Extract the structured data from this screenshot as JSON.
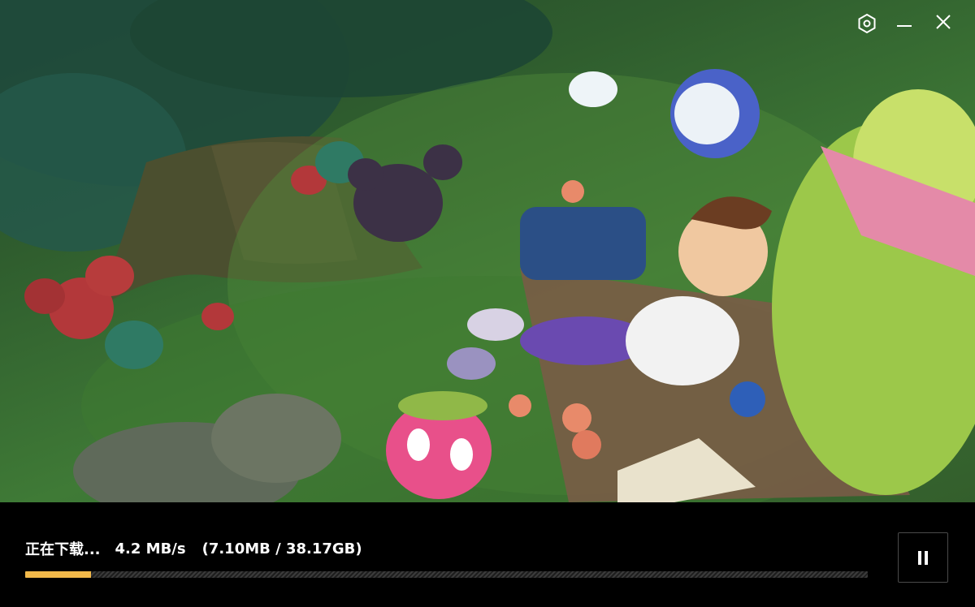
{
  "window": {
    "controls": [
      "settings-icon",
      "minimize-icon",
      "close-icon"
    ]
  },
  "banner": {
    "image": "game-artwork-boy-lying-on-picnic-blanket-with-creatures-in-forest"
  },
  "download": {
    "status_label": "正在下载...",
    "speed": "4.2 MB/s",
    "size_text": "(7.10MB / 38.17GB)",
    "progress_fraction": 0.078,
    "progress_color": "#f2b94a"
  },
  "controls": {
    "pause_icon": "pause-icon"
  }
}
